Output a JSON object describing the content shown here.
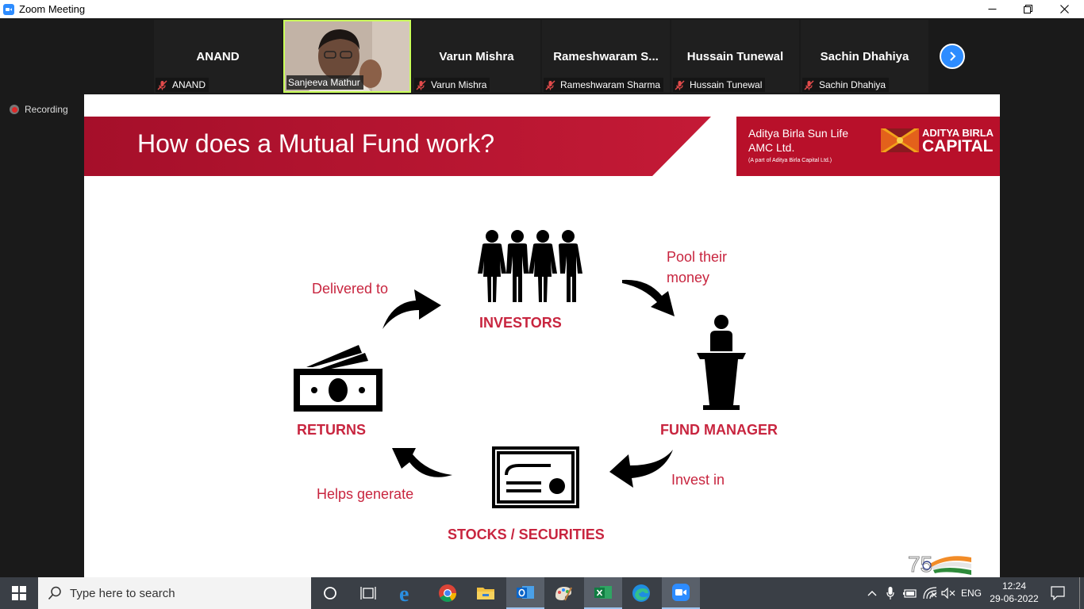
{
  "window": {
    "title": "Zoom Meeting",
    "controls": [
      "minimize",
      "restore",
      "close"
    ]
  },
  "gallery": {
    "participants": [
      {
        "name": "ANAND",
        "label": "ANAND",
        "muted": true,
        "video": false
      },
      {
        "name": "",
        "label": "Sanjeeva Mathur",
        "muted": false,
        "video": true
      },
      {
        "name": "Varun Mishra",
        "label": "Varun Mishra",
        "muted": true,
        "video": false
      },
      {
        "name": "Rameshwaram S...",
        "label": "Rameshwaram Sharma",
        "muted": true,
        "video": false
      },
      {
        "name": "Hussain Tunewal",
        "label": "Hussain Tunewal",
        "muted": true,
        "video": false
      },
      {
        "name": "Sachin Dhahiya",
        "label": "Sachin Dhahiya",
        "muted": true,
        "video": false
      }
    ],
    "next_icon": "chevron-right-icon"
  },
  "recording": {
    "label": "Recording"
  },
  "slide": {
    "title": "How does a Mutual Fund work?",
    "logo": {
      "company_line1": "Aditya Birla Sun Life",
      "company_line2": "AMC Ltd.",
      "company_note": "(A part of Aditya Birla Capital Ltd.)",
      "brand_line1": "ADITYA BIRLA",
      "brand_line2": "CAPITAL"
    },
    "nodes": {
      "investors": "INVESTORS",
      "fund_manager": "FUND MANAGER",
      "stocks": "STOCKS / SECURITIES",
      "returns": "RETURNS"
    },
    "flows": {
      "pool_line1": "Pool their",
      "pool_line2": "money",
      "invest": "Invest in",
      "generate": "Helps generate",
      "delivered": "Delivered to"
    },
    "colors": {
      "accent": "#c8253f",
      "banner": "#b8102a"
    }
  },
  "taskbar": {
    "search_placeholder": "Type here to search",
    "apps": [
      "cortana-icon",
      "task-view-icon",
      "edge-legacy-icon",
      "chrome-icon",
      "file-explorer-icon",
      "outlook-icon",
      "paint-icon",
      "excel-icon",
      "edge-icon",
      "zoom-icon"
    ],
    "language": "ENG",
    "time": "12:24",
    "date": "29-06-2022"
  }
}
